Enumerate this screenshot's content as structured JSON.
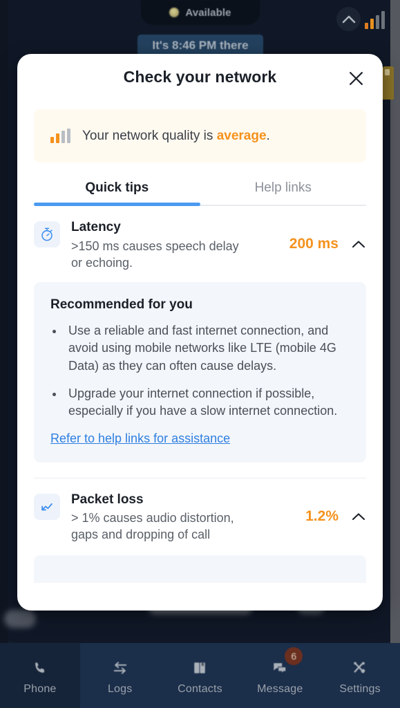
{
  "background": {
    "presence": {
      "status_label": "Available",
      "icon": "presence-dot-icon"
    },
    "time_bubble": {
      "text": "It's 8:46 PM there"
    },
    "collapse_icon": "chevron-up-icon",
    "signal_icon": "signal-bars-icon"
  },
  "modal": {
    "title": "Check your network",
    "close_icon": "close-icon",
    "banner": {
      "icon": "signal-bars-icon",
      "text_prefix": "Your network quality is ",
      "quality_word": "average",
      "text_suffix": ".",
      "quality_color": "#f5921e",
      "bg_color": "#fffaf0"
    },
    "tabs": [
      {
        "label": "Quick tips",
        "active": true
      },
      {
        "label": "Help links",
        "active": false
      }
    ],
    "accent_color": "#4a9af0",
    "metrics": [
      {
        "icon": "stopwatch-icon",
        "name": "Latency",
        "description": ">150 ms causes speech delay or echoing.",
        "value": "200 ms",
        "value_color": "#f5921e",
        "chevron": "chevron-up-icon",
        "expanded": true
      },
      {
        "icon": "trend-down-icon",
        "name": "Packet loss",
        "description": "> 1% causes audio distortion, gaps and dropping of call",
        "value": "1.2%",
        "value_color": "#f5921e",
        "chevron": "chevron-up-icon",
        "expanded": true
      }
    ],
    "recommendation": {
      "title": "Recommended for you",
      "bullets": [
        "Use a reliable and fast internet connection, and avoid using mobile networks like LTE (mobile 4G Data) as they can often cause delays.",
        "Upgrade your internet connection if possible, especially if you have a slow internet connection."
      ],
      "link_text": "Refer to help links for assistance",
      "link_color": "#2f7fe0"
    }
  },
  "bottom_nav": {
    "items": [
      {
        "label": "Phone",
        "icon": "phone-icon",
        "selected": true,
        "badge": ""
      },
      {
        "label": "Logs",
        "icon": "transfer-icon",
        "selected": false,
        "badge": ""
      },
      {
        "label": "Contacts",
        "icon": "book-icon",
        "selected": false,
        "badge": ""
      },
      {
        "label": "Message",
        "icon": "chat-icon",
        "selected": false,
        "badge": "6"
      },
      {
        "label": "Settings",
        "icon": "tools-icon",
        "selected": false,
        "badge": ""
      }
    ],
    "badge_color": "#6b2f20"
  }
}
